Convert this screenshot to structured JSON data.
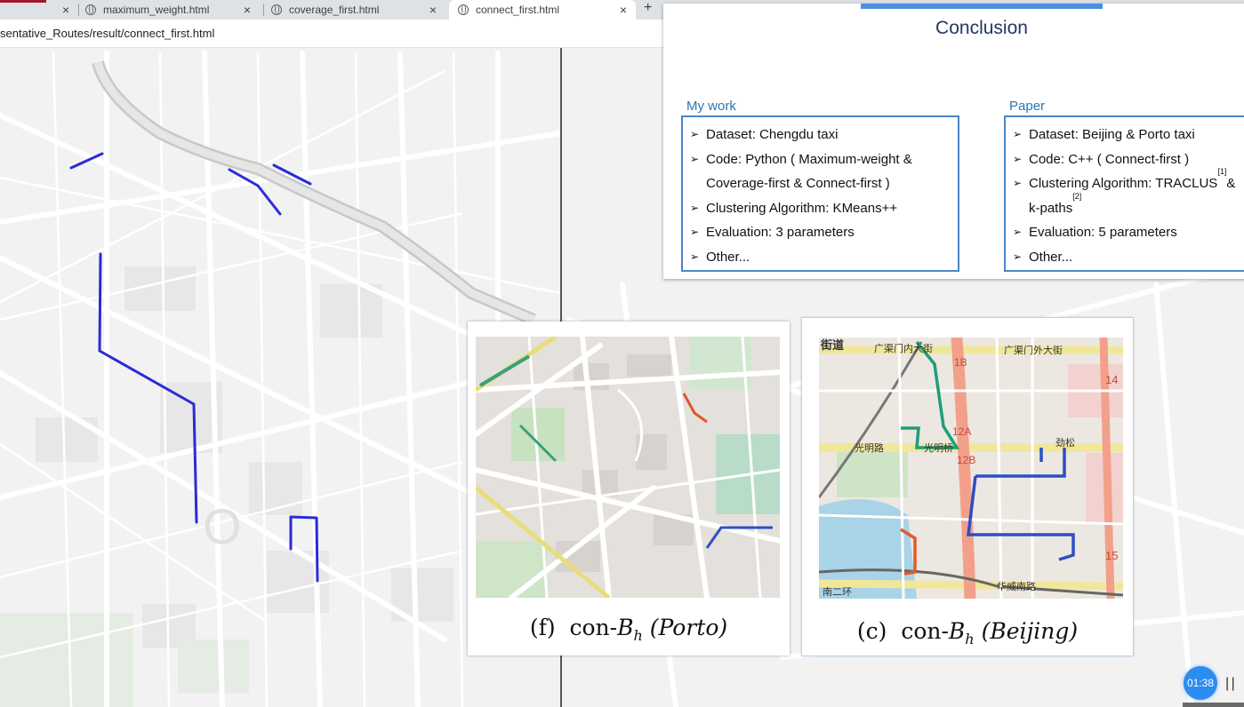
{
  "browser": {
    "tabs": [
      {
        "title": "maximum_weight.html",
        "active": false
      },
      {
        "title": "coverage_first.html",
        "active": false
      },
      {
        "title": "connect_first.html",
        "active": true
      }
    ],
    "new_tab_icon": "+",
    "close_icon": "×",
    "url": "sentative_Routes/result/connect_first.html"
  },
  "slide": {
    "title": "Conclusion",
    "left_heading": "My work",
    "right_heading": "Paper",
    "left_items": [
      {
        "text": "Dataset: Chengdu taxi"
      },
      {
        "text": "Code: Python ( Maximum-weight &"
      },
      {
        "text": "Coverage-first & Connect-first )",
        "cont": true
      },
      {
        "text": "Clustering Algorithm: KMeans++"
      },
      {
        "text": "Evaluation: 3 parameters"
      },
      {
        "text": "Other..."
      }
    ],
    "right_items": [
      {
        "text": "Dataset: Beijing & Porto taxi"
      },
      {
        "text": "Code: C++ ( Connect-first )"
      },
      {
        "text": "Clustering Algorithm: TRACLUS",
        "sup": "[1]",
        "tail": " &"
      },
      {
        "text": "k-paths",
        "sup": "[2]",
        "cont": true
      },
      {
        "text": "Evaluation: 5 parameters"
      },
      {
        "text": "Other..."
      }
    ],
    "bullet": "➢"
  },
  "figures": {
    "porto": {
      "label": "(f)",
      "method": "con-",
      "sym": "B",
      "sub": "h",
      "city": "(Porto)"
    },
    "beijing": {
      "label": "(c)",
      "method": "con-",
      "sym": "B",
      "sub": "h",
      "city": "(Beijing)"
    },
    "beijing_map_labels": [
      "街道",
      "广渠门内大街",
      "广渠门外大街",
      "1B",
      "12A",
      "12B",
      "光明路",
      "光明桥",
      "劲松",
      "14",
      "15",
      "南二环",
      "华威南路"
    ]
  },
  "player": {
    "timer": "01:38",
    "pause_icon": "| |"
  },
  "colors": {
    "route_blue": "#2b2bd6",
    "accent_blue": "#4a86c8",
    "title_navy": "#1f3864",
    "heading_blue": "#2e75b6",
    "timer_blue": "#2d8cf0"
  }
}
